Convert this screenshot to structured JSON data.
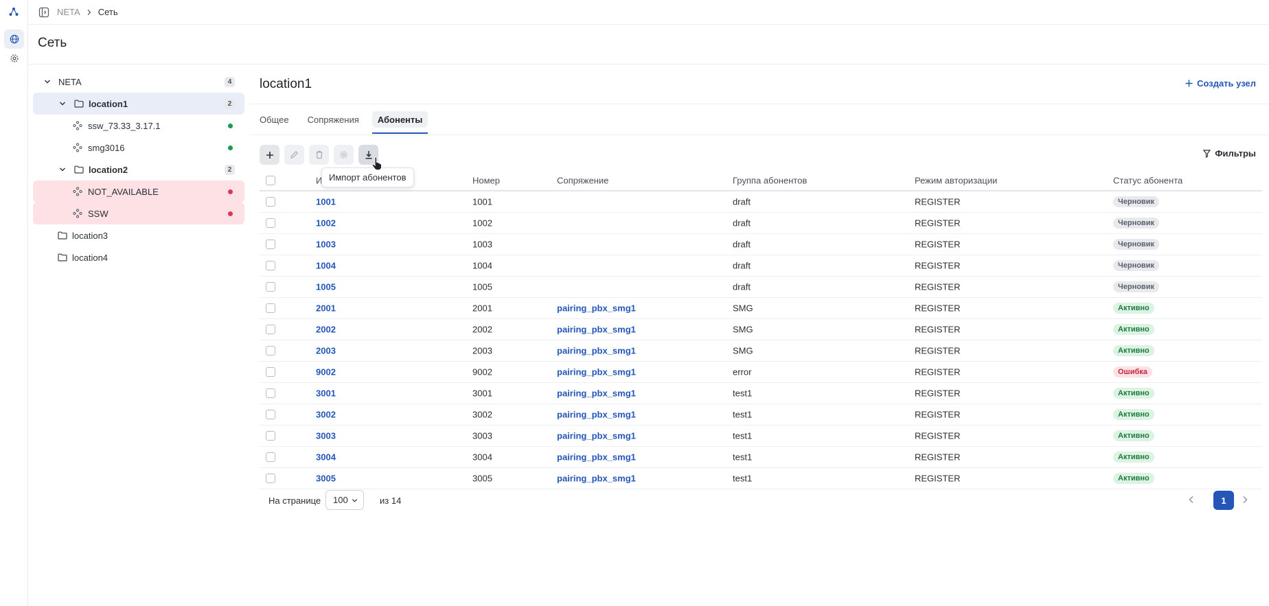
{
  "breadcrumb": {
    "root": "NETA",
    "current": "Сеть"
  },
  "page": {
    "title": "Сеть"
  },
  "tree": {
    "root": {
      "label": "NETA",
      "count": "4"
    },
    "nodes": [
      {
        "label": "location1",
        "count": "2"
      },
      {
        "label": "ssw_73.33_3.17.1",
        "status": "ok"
      },
      {
        "label": "smg3016",
        "status": "ok"
      },
      {
        "label": "location2",
        "count": "2"
      },
      {
        "label": "NOT_AVAILABLE",
        "status": "error"
      },
      {
        "label": "SSW",
        "status": "error"
      },
      {
        "label": "location3"
      },
      {
        "label": "location4"
      }
    ]
  },
  "main": {
    "title": "location1",
    "create_label": "Создать узел",
    "tabs": [
      "Общее",
      "Сопряжения",
      "Абоненты"
    ],
    "filters_label": "Фильтры",
    "tooltip": "Импорт абонентов"
  },
  "table": {
    "headers": {
      "id": "И",
      "number": "Номер",
      "pairing": "Сопряжение",
      "group": "Группа абонентов",
      "auth": "Режим авторизации",
      "status": "Статус абонента"
    },
    "rows": [
      {
        "id": "1001",
        "number": "1001",
        "pairing": "",
        "group": "draft",
        "auth": "REGISTER",
        "status": "Черновик",
        "kind": "draft"
      },
      {
        "id": "1002",
        "number": "1002",
        "pairing": "",
        "group": "draft",
        "auth": "REGISTER",
        "status": "Черновик",
        "kind": "draft"
      },
      {
        "id": "1003",
        "number": "1003",
        "pairing": "",
        "group": "draft",
        "auth": "REGISTER",
        "status": "Черновик",
        "kind": "draft"
      },
      {
        "id": "1004",
        "number": "1004",
        "pairing": "",
        "group": "draft",
        "auth": "REGISTER",
        "status": "Черновик",
        "kind": "draft"
      },
      {
        "id": "1005",
        "number": "1005",
        "pairing": "",
        "group": "draft",
        "auth": "REGISTER",
        "status": "Черновик",
        "kind": "draft"
      },
      {
        "id": "2001",
        "number": "2001",
        "pairing": "pairing_pbx_smg1",
        "group": "SMG",
        "auth": "REGISTER",
        "status": "Активно",
        "kind": "ok"
      },
      {
        "id": "2002",
        "number": "2002",
        "pairing": "pairing_pbx_smg1",
        "group": "SMG",
        "auth": "REGISTER",
        "status": "Активно",
        "kind": "ok"
      },
      {
        "id": "2003",
        "number": "2003",
        "pairing": "pairing_pbx_smg1",
        "group": "SMG",
        "auth": "REGISTER",
        "status": "Активно",
        "kind": "ok"
      },
      {
        "id": "9002",
        "number": "9002",
        "pairing": "pairing_pbx_smg1",
        "group": "error",
        "auth": "REGISTER",
        "status": "Ошибка",
        "kind": "err"
      },
      {
        "id": "3001",
        "number": "3001",
        "pairing": "pairing_pbx_smg1",
        "group": "test1",
        "auth": "REGISTER",
        "status": "Активно",
        "kind": "ok"
      },
      {
        "id": "3002",
        "number": "3002",
        "pairing": "pairing_pbx_smg1",
        "group": "test1",
        "auth": "REGISTER",
        "status": "Активно",
        "kind": "ok"
      },
      {
        "id": "3003",
        "number": "3003",
        "pairing": "pairing_pbx_smg1",
        "group": "test1",
        "auth": "REGISTER",
        "status": "Активно",
        "kind": "ok"
      },
      {
        "id": "3004",
        "number": "3004",
        "pairing": "pairing_pbx_smg1",
        "group": "test1",
        "auth": "REGISTER",
        "status": "Активно",
        "kind": "ok"
      },
      {
        "id": "3005",
        "number": "3005",
        "pairing": "pairing_pbx_smg1",
        "group": "test1",
        "auth": "REGISTER",
        "status": "Активно",
        "kind": "ok"
      }
    ]
  },
  "pagination": {
    "per_page_label": "На странице",
    "per_page_value": "100",
    "of_label": "из 14",
    "current_page": "1"
  },
  "colors": {
    "accent": "#2456b8",
    "ok": "#1e9a4b",
    "error": "#e0344f"
  }
}
